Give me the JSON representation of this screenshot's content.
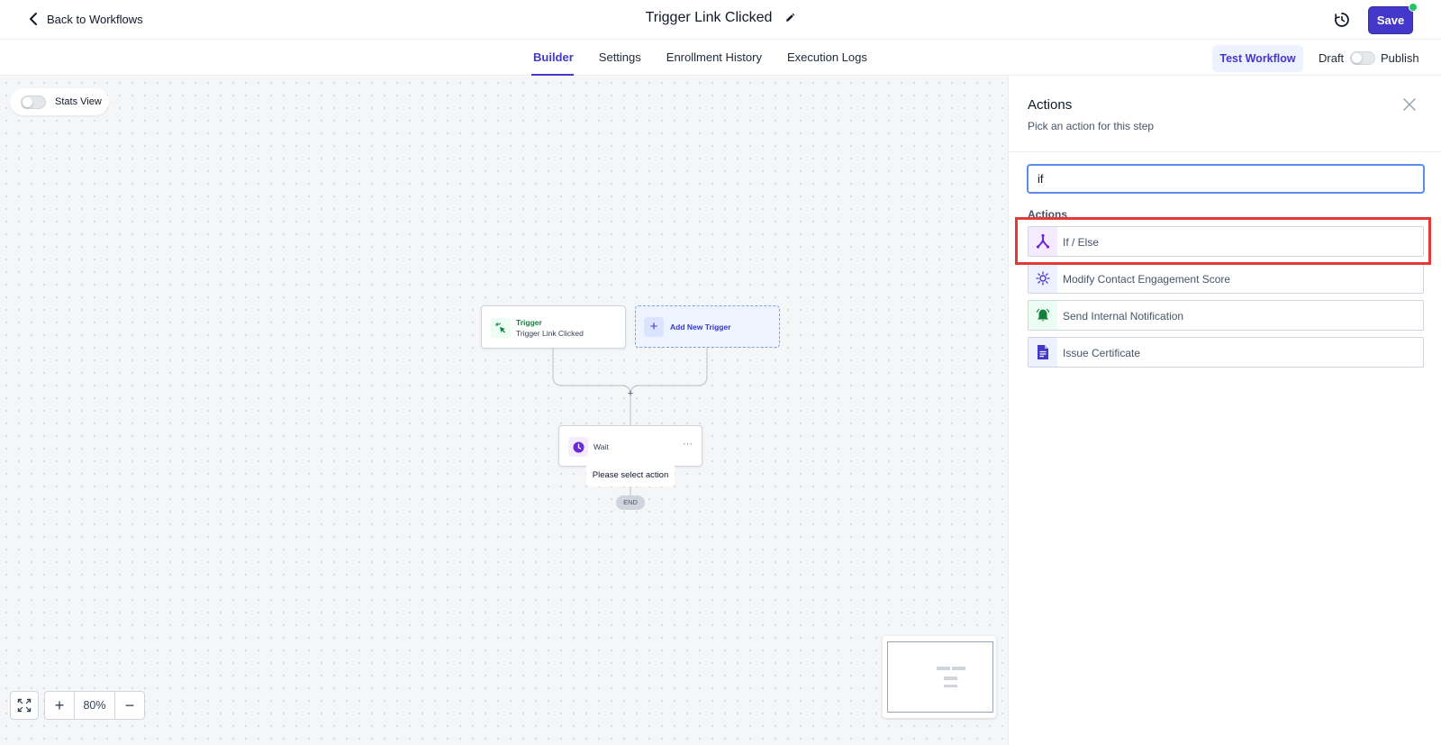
{
  "header": {
    "back_label": "Back to Workflows",
    "title": "Trigger Link Clicked",
    "save_label": "Save"
  },
  "tabs": [
    {
      "label": "Builder",
      "active": true
    },
    {
      "label": "Settings",
      "active": false
    },
    {
      "label": "Enrollment History",
      "active": false
    },
    {
      "label": "Execution Logs",
      "active": false
    }
  ],
  "toolbar": {
    "test_label": "Test Workflow",
    "draft_label": "Draft",
    "publish_label": "Publish",
    "published": false
  },
  "canvas": {
    "stats_label": "Stats View",
    "stats_enabled": false,
    "trigger_node": {
      "type_label": "Trigger",
      "name": "Trigger Link Clicked"
    },
    "add_trigger_label": "Add New Trigger",
    "add_step_symbol": "+",
    "wait_node": {
      "label": "Wait",
      "menu": "···"
    },
    "select_action_tip": "Please select action",
    "end_label": "END",
    "zoom": {
      "value": "80%",
      "plus": "+",
      "minus": "−"
    }
  },
  "panel": {
    "title": "Actions",
    "subtitle": "Pick an action for this step",
    "search_value": "if",
    "section_label": "Actions",
    "actions": [
      {
        "label": "If / Else",
        "icon": "branch-icon"
      },
      {
        "label": "Modify Contact Engagement Score",
        "icon": "sun-icon"
      },
      {
        "label": "Send Internal Notification",
        "icon": "bell-icon"
      },
      {
        "label": "Issue Certificate",
        "icon": "document-icon"
      }
    ]
  },
  "colors": {
    "accent": "#4338ca",
    "highlight": "#e53935",
    "trigger_green": "#15803d",
    "status_dot": "#22c55e"
  }
}
